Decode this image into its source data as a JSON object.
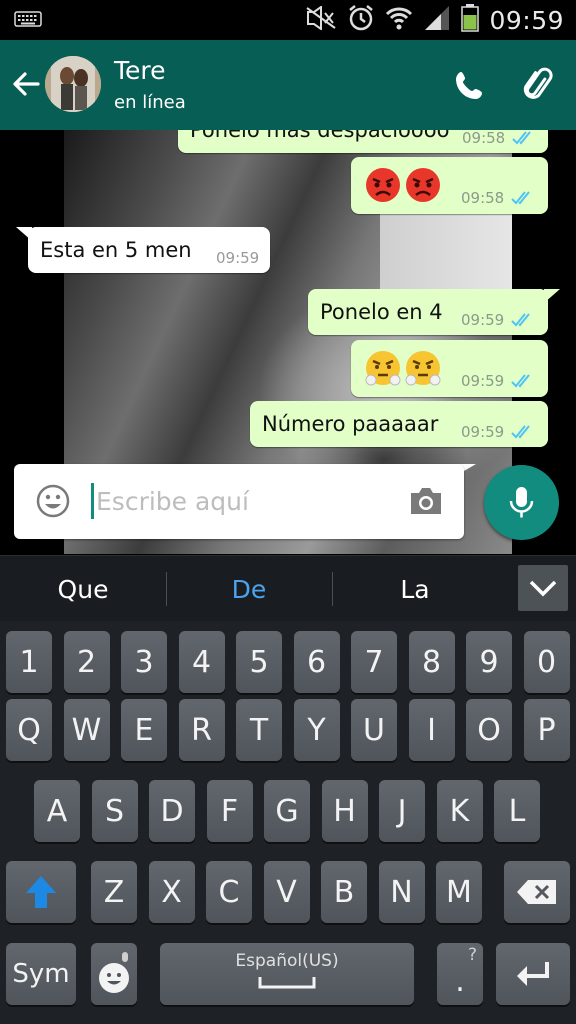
{
  "status_bar": {
    "time": "09:59",
    "icons": [
      "keyboard-icon",
      "silent-mode-icon",
      "alarm-icon",
      "wifi-icon",
      "signal-icon",
      "battery-icon"
    ]
  },
  "header": {
    "contact_name": "Tere",
    "contact_status": "en línea",
    "icons": [
      "back-arrow-icon",
      "call-icon",
      "attach-icon"
    ]
  },
  "messages": [
    {
      "direction": "out",
      "text": "Ponelo mas despacioooo",
      "time": "09:58",
      "ticks": "read"
    },
    {
      "direction": "out",
      "emoji": [
        "angry-face",
        "angry-face"
      ],
      "time": "09:58",
      "ticks": "read"
    },
    {
      "direction": "in",
      "text": "Esta en 5 men",
      "time": "09:59"
    },
    {
      "direction": "out",
      "text": "Ponelo en 4",
      "time": "09:59",
      "ticks": "read"
    },
    {
      "direction": "out",
      "emoji": [
        "triumph-face",
        "triumph-face"
      ],
      "time": "09:59",
      "ticks": "read"
    },
    {
      "direction": "out",
      "text": "Número paaaaar",
      "time": "09:59",
      "ticks": "read"
    }
  ],
  "input": {
    "placeholder": "Escribe aquí",
    "value": ""
  },
  "suggestions": {
    "items": [
      "Que",
      "De",
      "La"
    ],
    "highlighted_index": 1
  },
  "keyboard": {
    "row_numbers": [
      "1",
      "2",
      "3",
      "4",
      "5",
      "6",
      "7",
      "8",
      "9",
      "0"
    ],
    "row1": [
      "Q",
      "W",
      "E",
      "R",
      "T",
      "Y",
      "U",
      "I",
      "O",
      "P"
    ],
    "row2": [
      "A",
      "S",
      "D",
      "F",
      "G",
      "H",
      "J",
      "K",
      "L"
    ],
    "row3": [
      "Z",
      "X",
      "C",
      "V",
      "B",
      "N",
      "M"
    ],
    "sym_label": "Sym",
    "language_label": "Español(US)",
    "punct_label": ".",
    "punct_alt": "?"
  },
  "colors": {
    "header": "#075e54",
    "accent": "#128c7e",
    "outgoing_bubble": "#e2ffc7",
    "incoming_bubble": "#ffffff",
    "read_ticks": "#4fc3f7",
    "suggestion_highlight": "#4aa3ec",
    "shift_active": "#1e88e5"
  }
}
